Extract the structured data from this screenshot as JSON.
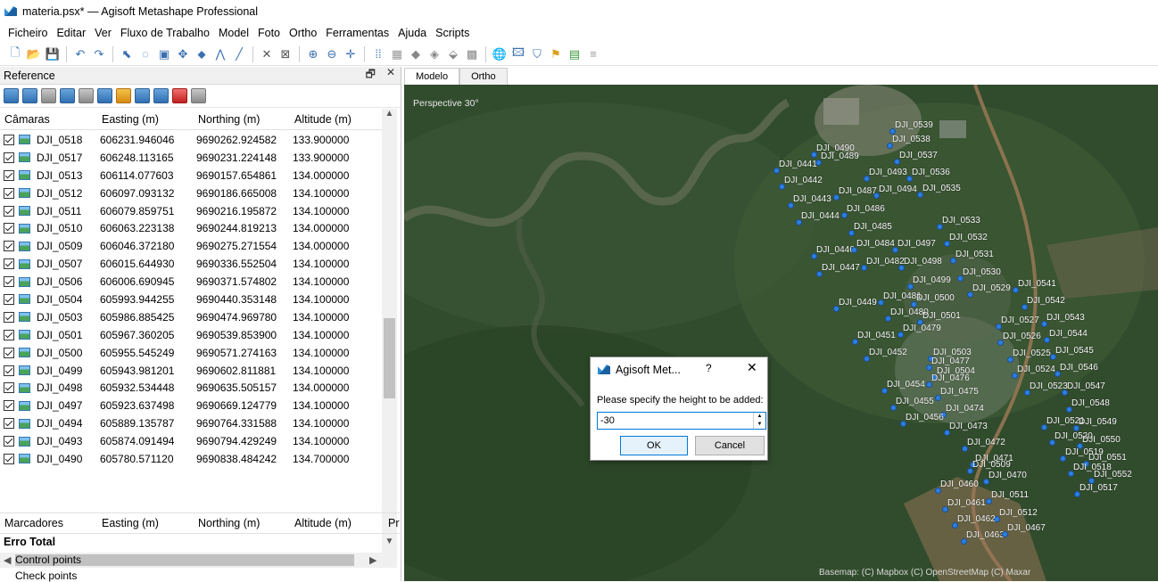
{
  "window": {
    "title": "materia.psx* — Agisoft Metashape Professional"
  },
  "menu": [
    "Ficheiro",
    "Editar",
    "Ver",
    "Fluxo de Trabalho",
    "Model",
    "Foto",
    "Ortho",
    "Ferramentas",
    "Ajuda",
    "Scripts"
  ],
  "reference_panel": {
    "title": "Reference",
    "float_label": "🗗",
    "close_label": "✕",
    "columns": [
      "Câmaras",
      "Easting (m)",
      "Northing (m)",
      "Altitude (m)"
    ],
    "rows": [
      {
        "name": "DJI_0518",
        "easting": "606231.946046",
        "northing": "9690262.924582",
        "altitude": "133.900000"
      },
      {
        "name": "DJI_0517",
        "easting": "606248.113165",
        "northing": "9690231.224148",
        "altitude": "133.900000"
      },
      {
        "name": "DJI_0513",
        "easting": "606114.077603",
        "northing": "9690157.654861",
        "altitude": "134.000000"
      },
      {
        "name": "DJI_0512",
        "easting": "606097.093132",
        "northing": "9690186.665008",
        "altitude": "134.100000"
      },
      {
        "name": "DJI_0511",
        "easting": "606079.859751",
        "northing": "9690216.195872",
        "altitude": "134.100000"
      },
      {
        "name": "DJI_0510",
        "easting": "606063.223138",
        "northing": "9690244.819213",
        "altitude": "134.000000"
      },
      {
        "name": "DJI_0509",
        "easting": "606046.372180",
        "northing": "9690275.271554",
        "altitude": "134.000000"
      },
      {
        "name": "DJI_0507",
        "easting": "606015.644930",
        "northing": "9690336.552504",
        "altitude": "134.100000"
      },
      {
        "name": "DJI_0506",
        "easting": "606006.690945",
        "northing": "9690371.574802",
        "altitude": "134.100000"
      },
      {
        "name": "DJI_0504",
        "easting": "605993.944255",
        "northing": "9690440.353148",
        "altitude": "134.100000"
      },
      {
        "name": "DJI_0503",
        "easting": "605986.885425",
        "northing": "9690474.969780",
        "altitude": "134.100000"
      },
      {
        "name": "DJI_0501",
        "easting": "605967.360205",
        "northing": "9690539.853900",
        "altitude": "134.100000"
      },
      {
        "name": "DJI_0500",
        "easting": "605955.545249",
        "northing": "9690571.274163",
        "altitude": "134.100000"
      },
      {
        "name": "DJI_0499",
        "easting": "605943.981201",
        "northing": "9690602.811881",
        "altitude": "134.100000"
      },
      {
        "name": "DJI_0498",
        "easting": "605932.534448",
        "northing": "9690635.505157",
        "altitude": "134.000000"
      },
      {
        "name": "DJI_0497",
        "easting": "605923.637498",
        "northing": "9690669.124779",
        "altitude": "134.100000"
      },
      {
        "name": "DJI_0494",
        "easting": "605889.135787",
        "northing": "9690764.331588",
        "altitude": "134.100000"
      },
      {
        "name": "DJI_0493",
        "easting": "605874.091494",
        "northing": "9690794.429249",
        "altitude": "134.100000"
      },
      {
        "name": "DJI_0490",
        "easting": "605780.571120",
        "northing": "9690838.484242",
        "altitude": "134.700000"
      }
    ],
    "markers_columns": [
      "Marcadores",
      "Easting (m)",
      "Northing (m)",
      "Altitude (m)",
      "Pr"
    ],
    "error_total": "Erro Total",
    "control_points": "Control points",
    "check_points": "Check points"
  },
  "view_tabs": [
    "Modelo",
    "Ortho"
  ],
  "viewport": {
    "perspective_label": "Perspective 30°",
    "basemap_credit": "Basemap: (C) Mapbox (C) OpenStreetMap (C) Maxar",
    "cameras": [
      "DJI_0539",
      "DJI_0490",
      "DJI_0538",
      "DJI_0489",
      "DJI_0537",
      "DJI_0441",
      "DJI_0493",
      "DJI_0536",
      "DJI_0442",
      "DJI_0487",
      "DJI_0494",
      "DJI_0535",
      "DJI_0443",
      "DJI_0486",
      "DJI_0444",
      "DJI_0533",
      "DJI_0485",
      "DJI_0532",
      "DJI_0446",
      "DJI_0484",
      "DJI_0497",
      "DJI_0531",
      "DJI_0447",
      "DJI_0482",
      "DJI_0498",
      "DJI_0530",
      "DJI_0499",
      "DJI_0529",
      "DJI_0541",
      "DJI_0481",
      "DJI_0500",
      "DJI_0542",
      "DJI_0449",
      "DJI_0480",
      "DJI_0501",
      "DJI_0543",
      "DJI_0527",
      "DJI_0479",
      "DJI_0451",
      "DJI_0544",
      "DJI_0526",
      "DJI_0503",
      "DJI_0545",
      "DJI_0452",
      "DJI_0477",
      "DJI_0525",
      "DJI_0504",
      "DJI_0546",
      "DJI_0524",
      "DJI_0476",
      "DJI_0454",
      "DJI_0547",
      "DJI_0523",
      "DJI_0475",
      "DJI_0455",
      "DJI_0548",
      "DJI_0474",
      "DJI_0456",
      "DJI_0549",
      "DJI_0521",
      "DJI_0473",
      "DJI_0550",
      "DJI_0520",
      "DJI_0472",
      "DJI_0551",
      "DJI_0519",
      "DJI_0471",
      "DJI_0509",
      "DJI_0518",
      "DJI_0552",
      "DJI_0470",
      "DJI_0460",
      "DJI_0517",
      "DJI_0511",
      "DJI_0461",
      "DJI_0512",
      "DJI_0462",
      "DJI_0463",
      "DJI_0467"
    ]
  },
  "dialog": {
    "title": "Agisoft Met...",
    "help": "?",
    "close": "✕",
    "prompt": "Please specify the height to be added:",
    "value": "-30",
    "ok": "OK",
    "cancel": "Cancel"
  }
}
